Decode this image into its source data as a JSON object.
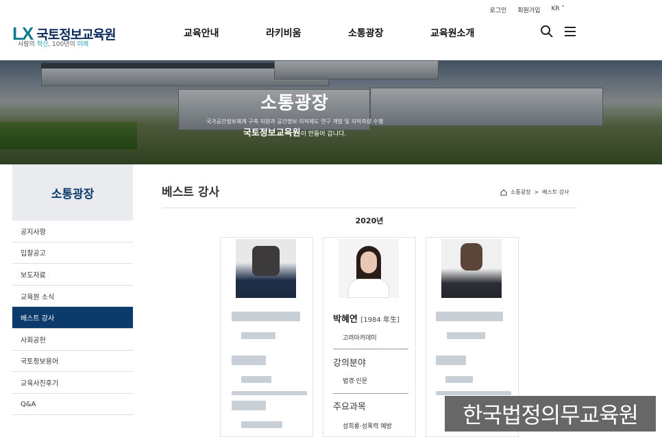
{
  "header": {
    "util": [
      "로그인",
      "회원가입",
      "KR ˅"
    ],
    "logo_mark": "LX",
    "logo_name": "국토정보교육원",
    "slogan_pre": "사람의 ",
    "slogan_hl1": "혁신",
    "slogan_mid": ", 100년의 ",
    "slogan_hl2": "미래",
    "nav": [
      "교육안내",
      "라키비움",
      "소통광장",
      "교육원소개"
    ]
  },
  "hero": {
    "title": "소통광장",
    "sub": "국가공간정보체계 구축 지원과 공간정보·지적제도 연구 개발 및 지적측량 수행",
    "sub2_bold": "국토정보교육원",
    "sub2_rest": "이 만들어 갑니다."
  },
  "sidebar": {
    "title": "소통광장",
    "items": [
      "공지사항",
      "입찰공고",
      "보도자료",
      "교육원 소식",
      "베스트 강사",
      "사회공헌",
      "국토정보용어",
      "교육사진후기",
      "Q&A"
    ],
    "active_index": 4
  },
  "content": {
    "title": "베스트 강사",
    "breadcrumb": [
      "소통광장",
      ">",
      "베스트 강사"
    ],
    "year": "2020년",
    "featured": {
      "name": "박혜연",
      "birth": "[1984 年生]",
      "affiliation": "고려아카데미",
      "field_heading": "강의분야",
      "field_value": "법경·인문",
      "subject_heading": "주요과목",
      "subject_value": "성희롱·성폭력 예방"
    }
  },
  "watermark": "한국법정의무교육원",
  "colors": {
    "primary": "#0c3a6b",
    "accent": "#1aa0b4"
  }
}
